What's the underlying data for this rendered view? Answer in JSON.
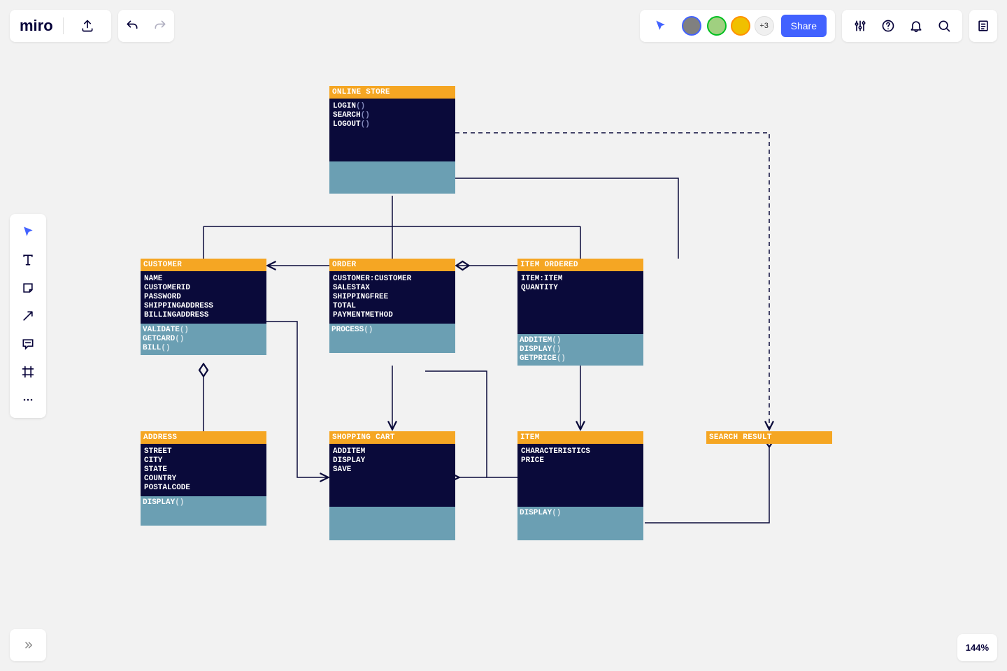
{
  "app": {
    "logo": "miro"
  },
  "header": {
    "share_label": "Share",
    "more_count": "+3"
  },
  "zoom": "144%",
  "classes": {
    "online_store": {
      "title": "ONLINE STORE",
      "attrs": [
        "LOGIN",
        "SEARCH",
        "LOGOUT"
      ],
      "attrs_raw": [
        "LOGIN()",
        "SEARCH()",
        "LOGOUT()"
      ],
      "methods": []
    },
    "customer": {
      "title": "CUSTOMER",
      "attrs_raw": [
        "NAME",
        "CUSTOMERID",
        "PASSWORD",
        "SHIPPINGADDRESS",
        "BILLINGADDRESS"
      ],
      "methods": [
        "VALIDATE",
        "GETCARD",
        "BILL"
      ],
      "methods_raw": [
        "VALIDATE()",
        "GETCARD()",
        "BILL()"
      ]
    },
    "order": {
      "title": "ORDER",
      "attrs_raw": [
        "CUSTOMER:CUSTOMER",
        "SALESTAX",
        "SHIPPINGFREE",
        "TOTAL",
        "PAYMENTMETHOD"
      ],
      "methods": [
        "PROCESS"
      ],
      "methods_raw": [
        "PROCESS()"
      ]
    },
    "item_ordered": {
      "title": "ITEM ORDERED",
      "attrs_raw": [
        "ITEM:ITEM",
        "QUANTITY"
      ],
      "methods": [
        "ADDITEM",
        "DISPLAY",
        "GETPRICE"
      ],
      "methods_raw": [
        "ADDITEM()",
        "DISPLAY()",
        "GETPRICE()"
      ]
    },
    "address": {
      "title": "ADDRESS",
      "attrs_raw": [
        "STREET",
        "CITY",
        "STATE",
        "COUNTRY",
        "POSTALCODE"
      ],
      "methods": [
        "DISPLAY"
      ],
      "methods_raw": [
        "DISPLAY()"
      ]
    },
    "shopping_cart": {
      "title": "SHOPPING CART",
      "attrs_raw": [
        "ADDITEM",
        "DISPLAY",
        "SAVE"
      ],
      "methods": []
    },
    "item": {
      "title": "ITEM",
      "attrs_raw": [
        "CHARACTERISTICS",
        "PRICE"
      ],
      "methods": [
        "DISPLAY"
      ],
      "methods_raw": [
        "DISPLAY()"
      ]
    },
    "search_result": {
      "title": "SEARCH RESULT"
    }
  }
}
